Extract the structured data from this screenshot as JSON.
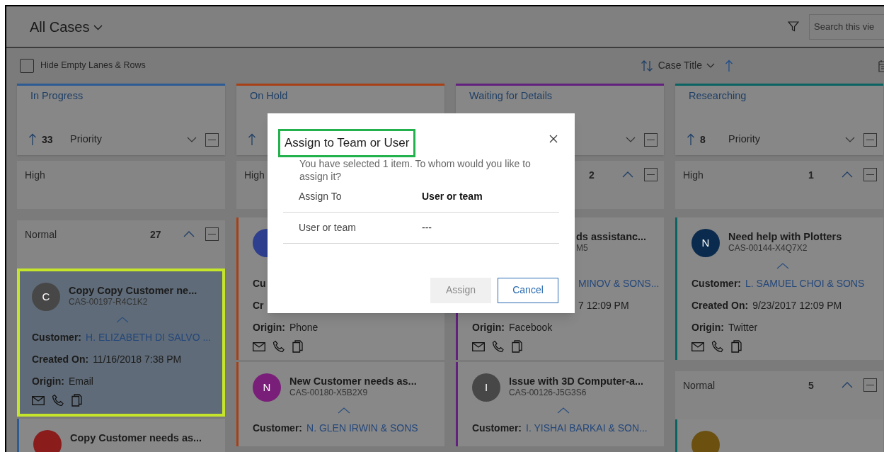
{
  "view": {
    "title": "All Cases",
    "search": {
      "placeholder": "Search this vie"
    }
  },
  "toolbar": {
    "hide_empty": {
      "label": "Hide Empty Lanes & Rows",
      "checked": false
    },
    "sort_field": "Case Title"
  },
  "lanes": [
    {
      "title": "In Progress",
      "color": "#2d5b94",
      "header": {
        "sort_arrow": true,
        "count": "33",
        "sort_label": "Priority",
        "menus": true
      },
      "groups": [
        {
          "label": "High"
        },
        {
          "label": "Normal",
          "count": "27",
          "expanded": true,
          "cards": [
            {
              "selected": true,
              "avatar": {
                "letter": "C",
                "color": "#474747"
              },
              "title": "Copy Copy Customer ne...",
              "id": "CAS-00197-R4C1K2",
              "expanded": true,
              "fields": [
                {
                  "label": "Customer:",
                  "value": "H. ELIZABETH DI SALVO ...",
                  "kind": "link"
                },
                {
                  "label": "Created On:",
                  "value": "11/16/2018 7:38 PM",
                  "kind": "text"
                },
                {
                  "label": "Origin:",
                  "value": "Email",
                  "kind": "text"
                }
              ],
              "quick_actions": true
            },
            {
              "selected": false,
              "avatar": {
                "color": "#8a1c1c"
              },
              "title": "Copy Customer needs as..."
            }
          ]
        }
      ]
    },
    {
      "title": "On Hold",
      "color": "#a84016",
      "header": {
        "sort_arrow": true,
        "menus": false
      },
      "groups": [
        {
          "label": "High",
          "cards": [
            {
              "selected": false,
              "avatar": {
                "color": "#2e3f8f"
              },
              "fields": [
                {
                  "label": "Cu"
                },
                {
                  "label": "Cr"
                },
                {
                  "label": "Origin:",
                  "value": "Phone",
                  "kind": "text"
                }
              ],
              "quick_actions": true
            },
            {
              "selected": false,
              "avatar": {
                "letter": "N",
                "color": "#7a1f79"
              },
              "title": "New Customer needs as...",
              "id": "CAS-00180-X5B2X9",
              "expanded": true,
              "fields": [
                {
                  "label": "Customer:",
                  "value": "N. GLEN IRWIN & SONS",
                  "kind": "link"
                }
              ]
            }
          ]
        }
      ]
    },
    {
      "title": "Waiting for Details",
      "color": "#63217f",
      "header": {
        "sort_arrow": false,
        "menus": true
      },
      "groups": [
        {
          "count": "2",
          "expanded": true,
          "cards": [
            {
              "selected": false,
              "obscured": true,
              "title": "ds assistanc...",
              "id": "M5",
              "fields": [
                {
                  "value": "MINOV & SONS...",
                  "kind": "link"
                },
                {
                  "value": "7 12:09 PM",
                  "kind": "text"
                },
                {
                  "label": "Origin:",
                  "value": "Facebook",
                  "kind": "text"
                }
              ],
              "quick_actions": true
            },
            {
              "selected": false,
              "avatar": {
                "letter": "I",
                "color": "#474747"
              },
              "title": "Issue with 3D Computer-a...",
              "id": "CAS-00126-J5G3S6",
              "expanded": true,
              "fields": [
                {
                  "label": "Customer:",
                  "value": "I. YISHAI BARKAI & SON...",
                  "kind": "link"
                }
              ]
            }
          ]
        }
      ]
    },
    {
      "title": "Researching",
      "color": "#0b6464",
      "header": {
        "sort_arrow": true,
        "count": "8",
        "sort_label": "Priority",
        "menus": true
      },
      "groups": [
        {
          "label": "High",
          "count": "1",
          "expanded": true,
          "cards": [
            {
              "selected": false,
              "avatar": {
                "letter": "N",
                "color": "#0a2b4d"
              },
              "title": "Need help with Plotters",
              "id": "CAS-00144-X4Q7X2",
              "expanded": true,
              "fields": [
                {
                  "label": "Customer:",
                  "value": "L. SAMUEL CHOI & SONS",
                  "kind": "link"
                },
                {
                  "label": "Created On:",
                  "value": "9/23/2017 12:09 PM",
                  "kind": "text"
                },
                {
                  "label": "Origin:",
                  "value": "Twitter",
                  "kind": "text"
                }
              ],
              "quick_actions": true
            }
          ]
        },
        {
          "label": "Normal",
          "count": "5",
          "expanded": true,
          "cards": [
            {
              "selected": false,
              "avatar": {
                "color": "#6b5010"
              }
            }
          ]
        }
      ]
    }
  ],
  "dialog": {
    "title": "Assign to Team or User",
    "title_highlighted": true,
    "message": "You have selected 1 item. To whom would you like to assign it?",
    "fields": [
      {
        "label": "Assign To",
        "value": "User or team",
        "kind": "option"
      },
      {
        "label": "User or team",
        "value": "---",
        "kind": "lookup"
      }
    ],
    "buttons": [
      {
        "label": "Assign",
        "disabled": true
      },
      {
        "label": "Cancel",
        "disabled": false
      }
    ]
  }
}
